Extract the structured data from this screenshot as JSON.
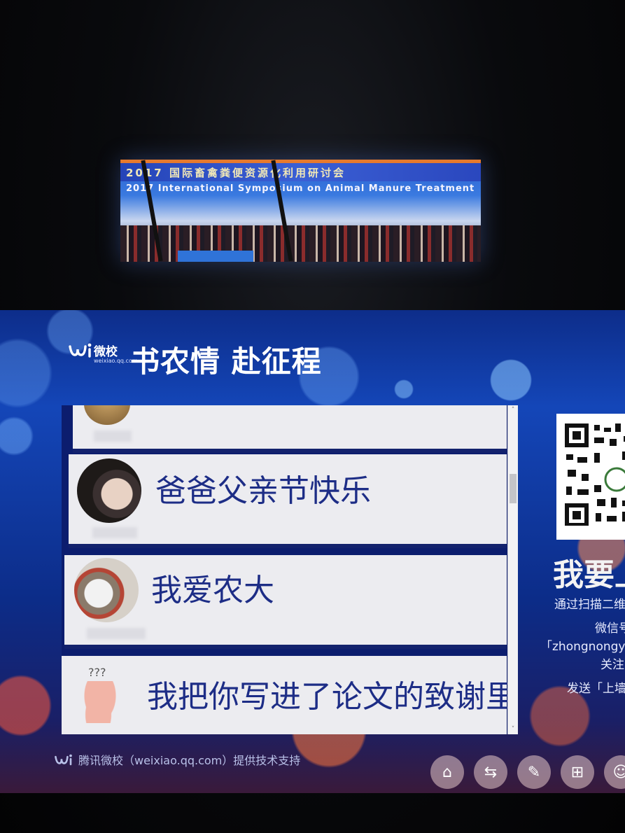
{
  "banner": {
    "line1": "2017 国际畜禽粪便资源化利用研讨会",
    "line2": "2017 International Symposium on Animal Manure Treatment a"
  },
  "header": {
    "logo_text": "微校",
    "logo_sub": "weixiao.qq.com",
    "title": "书农情 赴征程"
  },
  "messages": [
    {
      "text": ""
    },
    {
      "text": "爸爸父亲节快乐"
    },
    {
      "text": "我爱农大"
    },
    {
      "text": "我把你写进了论文的致谢里"
    }
  ],
  "sidebar": {
    "join_title": "我要上",
    "line1": "通过扫描二维",
    "line2": "微信号",
    "line3": "「zhongnongy",
    "line4": "关注",
    "line5": "发送「上墙"
  },
  "footer": {
    "text": "腾讯微校（weixiao.qq.com）提供技术支持",
    "icons": [
      "home-icon",
      "shake-icon",
      "edit-icon",
      "gift-icon",
      "user-icon"
    ],
    "icon_glyphs": [
      "⌂",
      "⇆",
      "✎",
      "⊞",
      "☺"
    ]
  },
  "question_marks": "???"
}
